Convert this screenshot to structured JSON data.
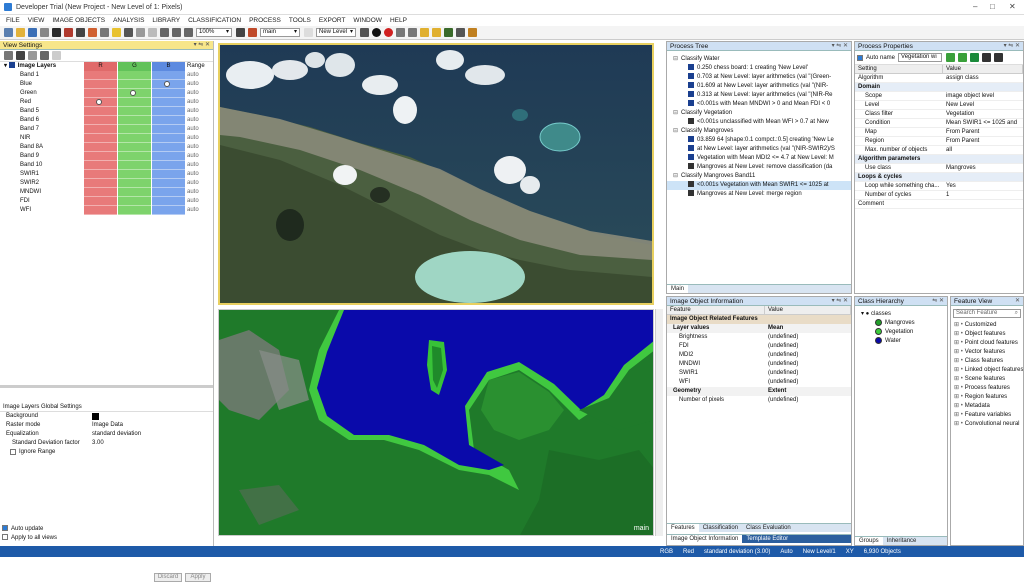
{
  "window": {
    "title": "Developer Trial (New Project - New Level of 1: Pixels)"
  },
  "menu": [
    "FILE",
    "VIEW",
    "IMAGE OBJECTS",
    "ANALYSIS",
    "LIBRARY",
    "CLASSIFICATION",
    "PROCESS",
    "TOOLS",
    "EXPORT",
    "WINDOW",
    "HELP"
  ],
  "toolbar": {
    "zoom": "100%",
    "map": "main",
    "level": "New Level"
  },
  "view_settings": {
    "title": "View Settings",
    "section": "Image Layers",
    "columns": [
      "R",
      "G",
      "B",
      "Range"
    ],
    "layers": [
      {
        "name": "Band 1",
        "range": "auto"
      },
      {
        "name": "Blue",
        "range": "auto"
      },
      {
        "name": "Green",
        "range": "auto"
      },
      {
        "name": "Red",
        "range": "auto"
      },
      {
        "name": "Band 5",
        "range": "auto"
      },
      {
        "name": "Band 6",
        "range": "auto"
      },
      {
        "name": "Band 7",
        "range": "auto"
      },
      {
        "name": "NIR",
        "range": "auto"
      },
      {
        "name": "Band 8A",
        "range": "auto"
      },
      {
        "name": "Band 9",
        "range": "auto"
      },
      {
        "name": "Band 10",
        "range": "auto"
      },
      {
        "name": "SWIR1",
        "range": "auto"
      },
      {
        "name": "SWIR2",
        "range": "auto"
      },
      {
        "name": "MNDWI",
        "range": "auto"
      },
      {
        "name": "FDI",
        "range": "auto"
      },
      {
        "name": "WFI",
        "range": "auto"
      }
    ],
    "global": {
      "title": "Image Layers Global Settings",
      "rows": [
        [
          "Background",
          ""
        ],
        [
          "Raster mode",
          "Image Data"
        ],
        [
          "Equalization",
          "standard deviation"
        ],
        [
          "Standard Deviation factor",
          "3.00"
        ],
        [
          "Ignore Range",
          ""
        ]
      ]
    },
    "auto_update": "Auto update",
    "apply_all": "Apply to all views",
    "discard": "Discard",
    "apply": "Apply"
  },
  "process_tree": {
    "title": "Process Tree",
    "tab": "Main",
    "items": [
      {
        "text": "Classify Water",
        "indent": 0,
        "icon": ""
      },
      {
        "text": "0.250   chess board: 1 creating 'New Level'",
        "indent": 1,
        "icon": "#1a3f8f"
      },
      {
        "text": "0.703   at  New Level: layer arithmetics (val \"(Green-",
        "indent": 1,
        "icon": "#1a3f8f"
      },
      {
        "text": "01.609   at  New Level: layer arithmetics (val \"(NIR-",
        "indent": 1,
        "icon": "#1a3f8f"
      },
      {
        "text": "0.313   at  New Level: layer arithmetics (val \"(NIR-Re",
        "indent": 1,
        "icon": "#1a3f8f"
      },
      {
        "text": "<0.001s   with Mean MNDWI > 0  and Mean FDI < 0",
        "indent": 1,
        "icon": "#1a3f8f"
      },
      {
        "text": "Classify Vegetation",
        "indent": 0,
        "icon": ""
      },
      {
        "text": "<0.001s   unclassified with Mean WFI > 0.7  at  New",
        "indent": 1,
        "icon": "#333"
      },
      {
        "text": "Classify Mangroves",
        "indent": 0,
        "icon": ""
      },
      {
        "text": "03.859   64 [shape:0.1 compct.:0.5] creating 'New Le",
        "indent": 1,
        "icon": "#1a3f8f"
      },
      {
        "text": "at  New Level: layer arithmetics (val \"(NIR-SWIR2)/S",
        "indent": 1,
        "icon": "#1a3f8f"
      },
      {
        "text": "Vegetation with Mean MDI2 <= 4.7  at  New Level: M",
        "indent": 1,
        "icon": "#1a3f8f"
      },
      {
        "text": "Mangroves at  New Level: remove classification  (da",
        "indent": 1,
        "icon": "#333"
      },
      {
        "text": "Classify Mangroves Band11",
        "indent": 0,
        "icon": ""
      },
      {
        "text": "<0.001s   Vegetation with Mean SWIR1 <= 1025  at",
        "indent": 1,
        "icon": "#333",
        "selected": true
      },
      {
        "text": "Mangroves at  New Level: merge region",
        "indent": 1,
        "icon": "#333"
      }
    ]
  },
  "process_props": {
    "title": "Process Properties",
    "auto_name": "Auto name",
    "name_value": "Vegetation wi",
    "columns": [
      "Setting",
      "Value"
    ],
    "rows": [
      {
        "k": "Algorithm",
        "v": "assign class",
        "type": "plain"
      },
      {
        "k": "Domain",
        "v": "",
        "type": "head"
      },
      {
        "k": "Scope",
        "v": "image object level",
        "type": "sub"
      },
      {
        "k": "Level",
        "v": "New Level",
        "type": "sub"
      },
      {
        "k": "Class filter",
        "v": "Vegetation",
        "type": "sub"
      },
      {
        "k": "Condition",
        "v": "Mean SWIR1 <= 1025  and",
        "type": "sub"
      },
      {
        "k": "Map",
        "v": "From Parent",
        "type": "sub"
      },
      {
        "k": "Region",
        "v": "From Parent",
        "type": "sub"
      },
      {
        "k": "Max. number of objects",
        "v": "all",
        "type": "sub"
      },
      {
        "k": "Algorithm parameters",
        "v": "",
        "type": "head"
      },
      {
        "k": "Use class",
        "v": "Mangroves",
        "type": "sub"
      },
      {
        "k": "Loops & cycles",
        "v": "",
        "type": "head"
      },
      {
        "k": "Loop while something cha...",
        "v": "Yes",
        "type": "sub"
      },
      {
        "k": "Number of cycles",
        "v": "1",
        "type": "sub"
      },
      {
        "k": "Comment",
        "v": "",
        "type": "plain"
      }
    ]
  },
  "image_object_info": {
    "title": "Image Object Information",
    "columns": [
      "Feature",
      "Value"
    ],
    "section": "Image Object Related Features",
    "groups": [
      {
        "name": "Layer values",
        "col": "Mean",
        "rows": [
          [
            "Brightness",
            "(undefined)"
          ],
          [
            "FDI",
            "(undefined)"
          ],
          [
            "MDI2",
            "(undefined)"
          ],
          [
            "MNDWI",
            "(undefined)"
          ],
          [
            "SWIR1",
            "(undefined)"
          ],
          [
            "WFI",
            "(undefined)"
          ]
        ]
      },
      {
        "name": "Geometry",
        "col": "Extent",
        "rows": [
          [
            "Number of pixels",
            "(undefined)"
          ]
        ]
      }
    ],
    "tabs_top": [
      "Features",
      "Classification",
      "Class Evaluation"
    ],
    "tabs_bottom": [
      "Image Object Information",
      "Template Editor"
    ]
  },
  "class_hierarchy": {
    "title": "Class Hierarchy",
    "root": "classes",
    "classes": [
      {
        "name": "Mangroves",
        "color": "#22a02a"
      },
      {
        "name": "Vegetation",
        "color": "#3bcc3b"
      },
      {
        "name": "Water",
        "color": "#0a0aa8"
      }
    ],
    "tabs": [
      "Groups",
      "Inheritance"
    ]
  },
  "feature_view": {
    "title": "Feature View",
    "search": "Search Feature",
    "items": [
      "Customized",
      "Object features",
      "Point cloud features",
      "Vector features",
      "Class features",
      "Linked object features",
      "Scene features",
      "Process features",
      "Region features",
      "Metadata",
      "Feature variables",
      "Convolutional neural"
    ]
  },
  "map_label": "main",
  "status": {
    "items": [
      "RGB",
      "Red",
      "standard deviation (3.00)",
      "Auto",
      "New Level/1",
      "XY",
      "6,930 Objects"
    ]
  }
}
